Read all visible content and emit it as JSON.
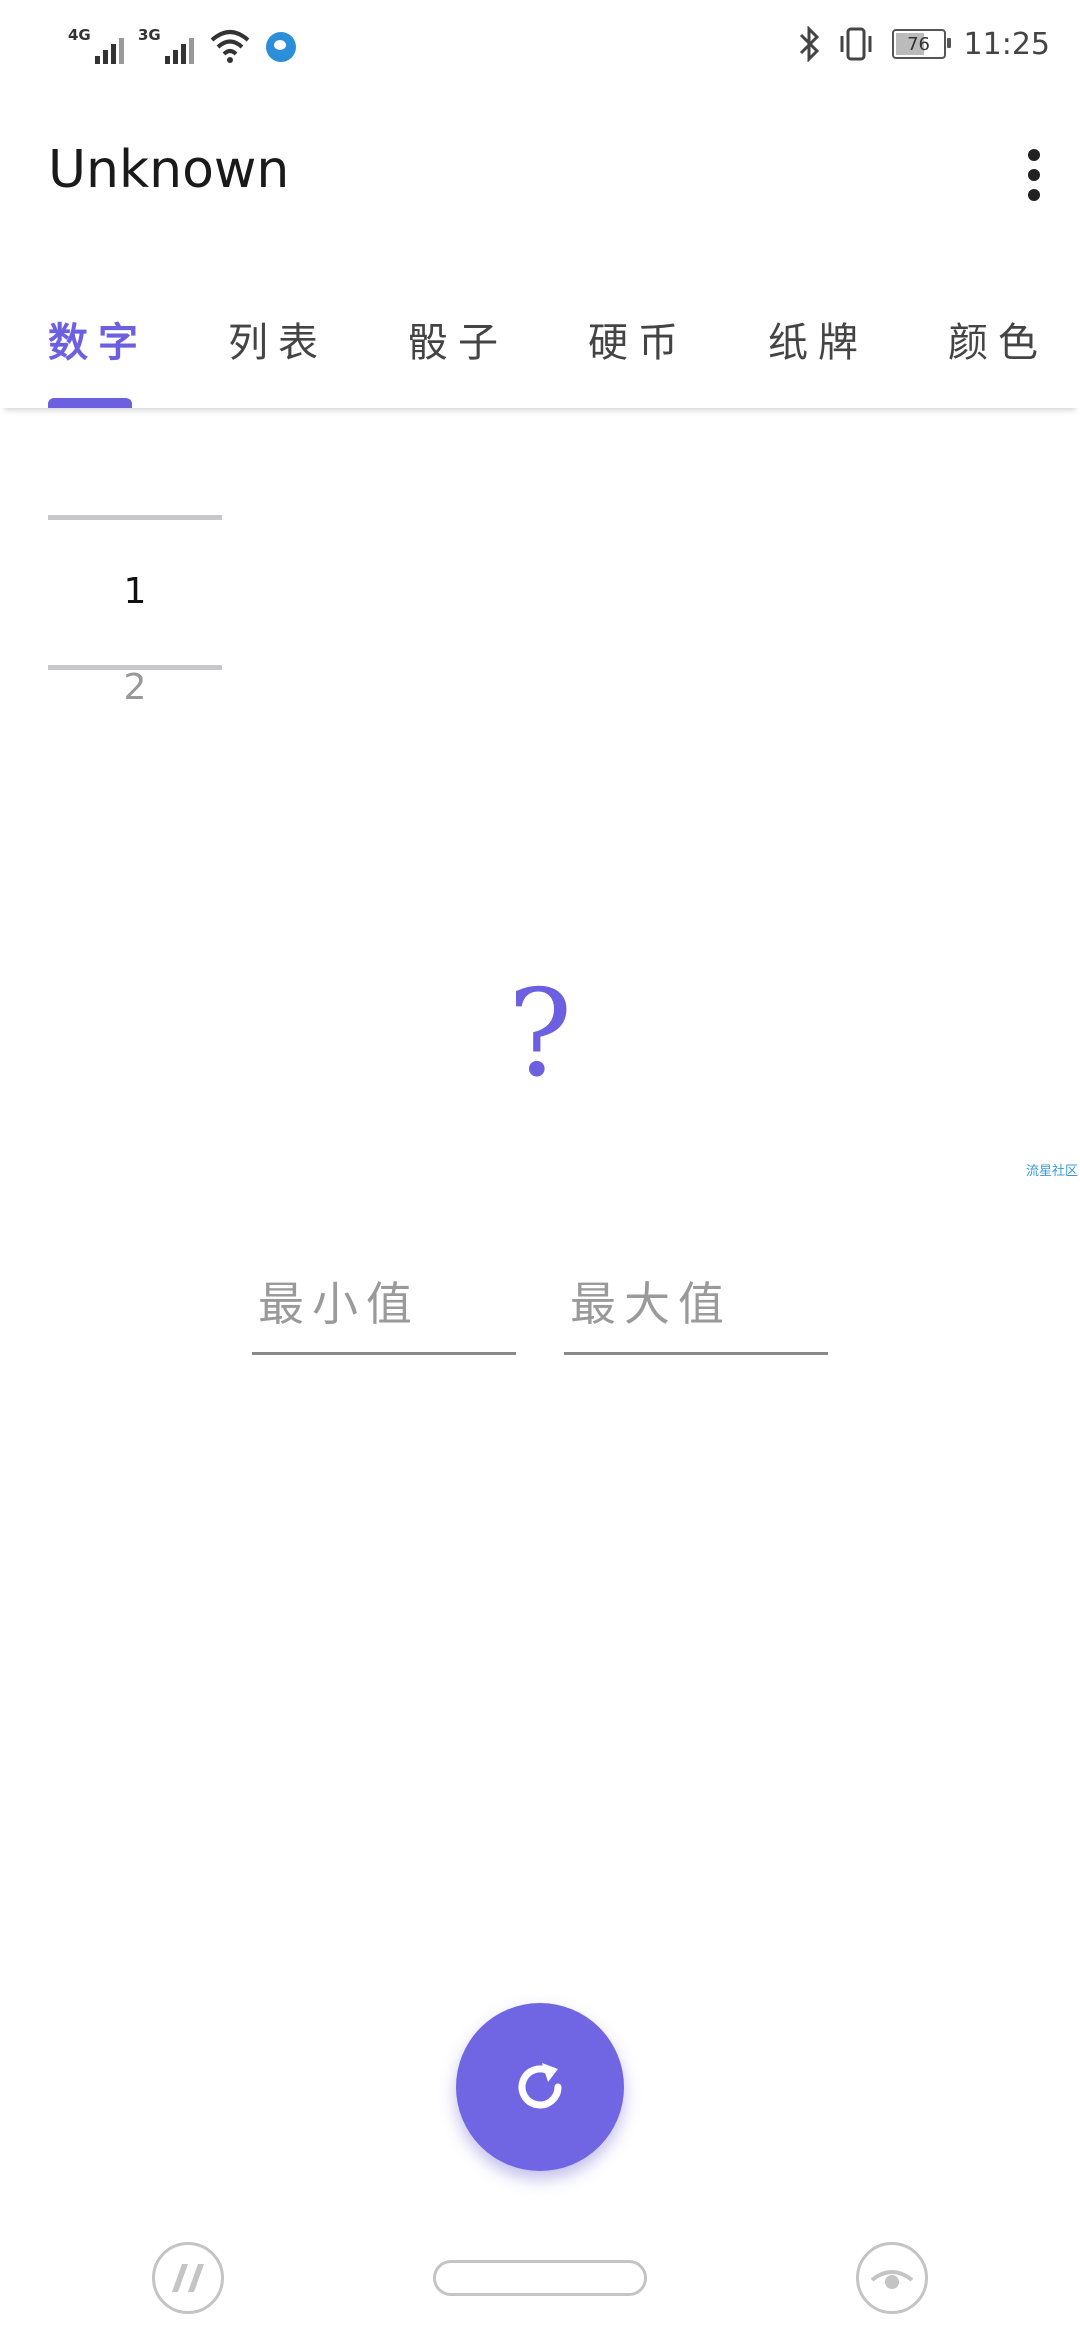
{
  "status_bar": {
    "network1": "4G",
    "network2": "3G",
    "battery": "76",
    "time": "11:25"
  },
  "app_bar": {
    "title": "Unknown",
    "more_icon": "more-vert-icon"
  },
  "tabs": [
    {
      "label": "数字",
      "active": true
    },
    {
      "label": "列表",
      "active": false
    },
    {
      "label": "骰子",
      "active": false
    },
    {
      "label": "硬币",
      "active": false
    },
    {
      "label": "纸牌",
      "active": false
    },
    {
      "label": "颜色",
      "active": false
    }
  ],
  "picker": {
    "current": "1",
    "next": "2"
  },
  "result": {
    "value": "?"
  },
  "side_link": "流星社区",
  "inputs": {
    "min_placeholder": "最小值",
    "max_placeholder": "最大值"
  },
  "fab": {
    "icon": "refresh-icon"
  },
  "colors": {
    "accent": "#6c5fe0",
    "fab": "#7066e4",
    "link": "#3a9bd8"
  }
}
